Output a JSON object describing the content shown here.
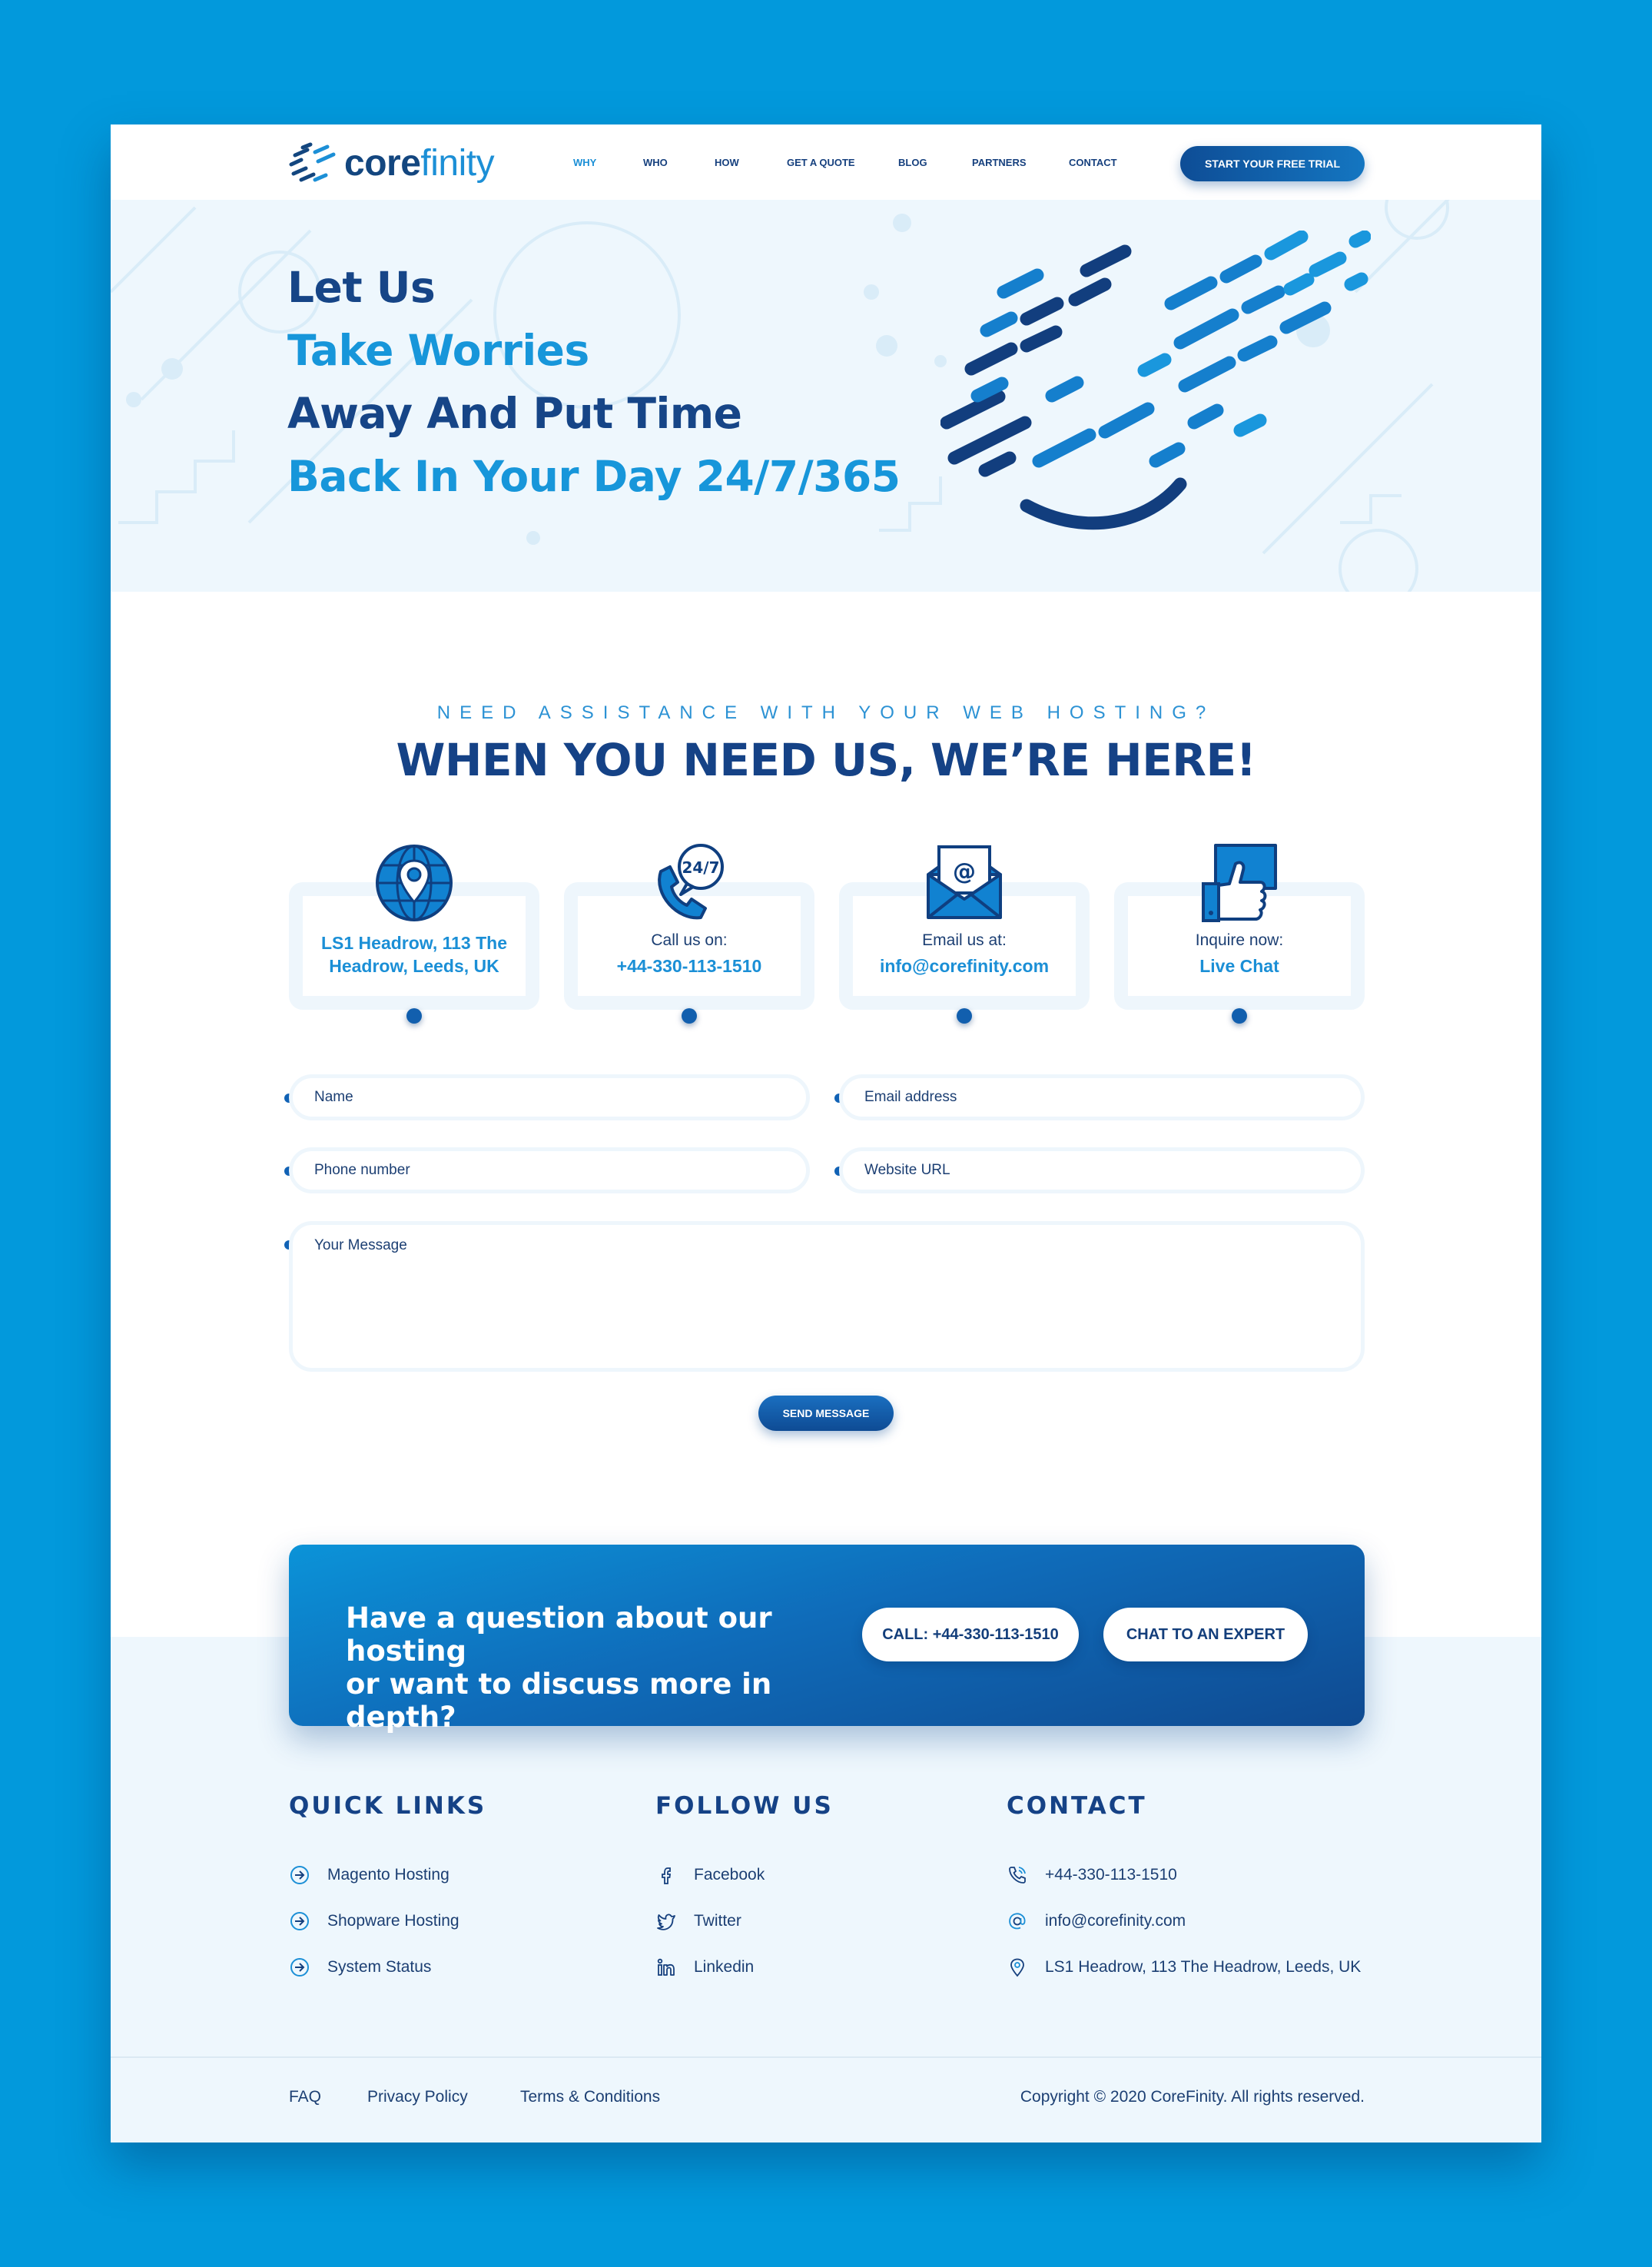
{
  "colors": {
    "background": "#0299dc",
    "primary_dark": "#16407e",
    "accent": "#1b8fd6",
    "hero_bg": "#eef7fd"
  },
  "header": {
    "logo": {
      "part1": "core",
      "part2": "finity"
    },
    "nav": [
      {
        "label": "WHY",
        "active": true
      },
      {
        "label": "WHO"
      },
      {
        "label": "HOW"
      },
      {
        "label": "GET A QUOTE"
      },
      {
        "label": "BLOG"
      },
      {
        "label": "PARTNERS"
      },
      {
        "label": "CONTACT"
      }
    ],
    "cta_label": "START YOUR FREE TRIAL"
  },
  "hero": {
    "lines": [
      "Let Us",
      "Take Worries",
      "Away And Put Time",
      "Back In Your Day 24/7/365"
    ]
  },
  "contact": {
    "kicker": "NEED ASSISTANCE WITH YOUR WEB HOSTING?",
    "title": "WHEN YOU NEED US, WE’RE HERE!",
    "cards": [
      {
        "icon": "location-globe-icon",
        "address_line1": "LS1 Headrow, 113 The",
        "address_line2": "Headrow, Leeds, UK"
      },
      {
        "icon": "phone-24-7-icon",
        "label": "Call us on:",
        "value": "+44-330-113-1510"
      },
      {
        "icon": "envelope-icon",
        "label": "Email us at:",
        "value": "info@corefinity.com"
      },
      {
        "icon": "chat-thumbs-up-icon",
        "label": "Inquire now:",
        "value": "Live Chat"
      }
    ],
    "form": {
      "name_placeholder": "Name",
      "email_placeholder": "Email address",
      "phone_placeholder": "Phone number",
      "website_placeholder": "Website URL",
      "message_placeholder": "Your Message",
      "submit_label": "SEND MESSAGE"
    }
  },
  "cta": {
    "text_line1": "Have a question about our hosting",
    "text_line2": "or want to discuss more in depth?",
    "call_label": "CALL: +44-330-113-1510",
    "chat_label": "CHAT TO AN EXPERT"
  },
  "footer": {
    "quick_links": {
      "title": "QUICK LINKS",
      "items": [
        "Magento Hosting",
        "Shopware Hosting",
        "System Status"
      ]
    },
    "follow_us": {
      "title": "FOLLOW US",
      "items": [
        "Facebook",
        "Twitter",
        "Linkedin"
      ]
    },
    "contact": {
      "title": "CONTACT",
      "items": [
        "+44-330-113-1510",
        "info@corefinity.com",
        "LS1 Headrow, 113 The Headrow, Leeds, UK"
      ]
    },
    "bottom_links": [
      "FAQ",
      "Privacy Policy",
      "Terms & Conditions"
    ],
    "copyright": "Copyright © 2020 CoreFinity. All rights reserved."
  }
}
